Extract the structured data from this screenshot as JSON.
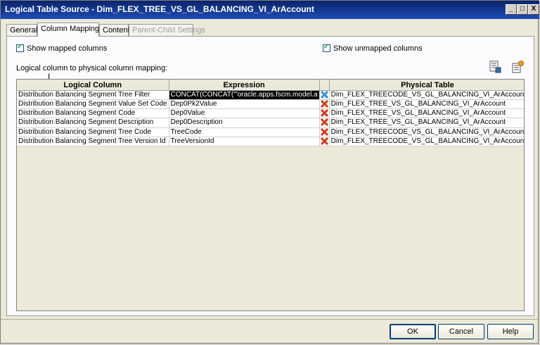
{
  "window": {
    "title": "Logical Table Source - Dim_FLEX_TREE_VS_GL_BALANCING_VI_ArAccount",
    "controls": {
      "minimize": "_",
      "maximize": "□",
      "close": "X"
    }
  },
  "tabs": [
    {
      "label": "General",
      "state": "normal"
    },
    {
      "label": "Column Mapping",
      "state": "active"
    },
    {
      "label": "Content",
      "state": "normal"
    },
    {
      "label": "Parent-Child Settings",
      "state": "disabled"
    }
  ],
  "options": {
    "show_mapped": {
      "label": "Show mapped columns",
      "checked": true
    },
    "show_unmapped": {
      "label": "Show unmapped columns",
      "checked": true
    }
  },
  "mapping_label": "Logical column to physical column mapping:",
  "toolbar": {
    "icons": [
      "expression-builder-icon",
      "add-column-icon"
    ]
  },
  "grid": {
    "headers": {
      "logical": "Logical Column",
      "expression": "Expression",
      "physical": "Physical Table"
    },
    "rows": [
      {
        "logical": "Distribution Balancing Segment Tree Filter",
        "expression": "CONCAT(CONCAT('\"oracle.apps.fscm.model.a",
        "physical": "Dim_FLEX_TREECODE_VS_GL_BALANCING_VI_ArAccoun",
        "selected": true
      },
      {
        "logical": "Distribution Balancing Segment Value Set Code",
        "expression": "Dep0Pk2Value",
        "physical": "Dim_FLEX_TREE_VS_GL_BALANCING_VI_ArAccount",
        "selected": false
      },
      {
        "logical": "Distribution Balancing Segment Code",
        "expression": "Dep0Value",
        "physical": "Dim_FLEX_TREE_VS_GL_BALANCING_VI_ArAccount",
        "selected": false
      },
      {
        "logical": "Distribution Balancing Segment Description",
        "expression": "Dep0Description",
        "physical": "Dim_FLEX_TREE_VS_GL_BALANCING_VI_ArAccount",
        "selected": false
      },
      {
        "logical": "Distribution Balancing Segment Tree Code",
        "expression": "TreeCode",
        "physical": "Dim_FLEX_TREECODE_VS_GL_BALANCING_VI_ArAccoun",
        "selected": false
      },
      {
        "logical": "Distribution Balancing Segment Tree Version Id",
        "expression": "TreeVersionId",
        "physical": "Dim_FLEX_TREECODE_VS_GL_BALANCING_VI_ArAccoun",
        "selected": false
      }
    ]
  },
  "buttons": {
    "ok": "OK",
    "cancel": "Cancel",
    "help": "Help"
  }
}
